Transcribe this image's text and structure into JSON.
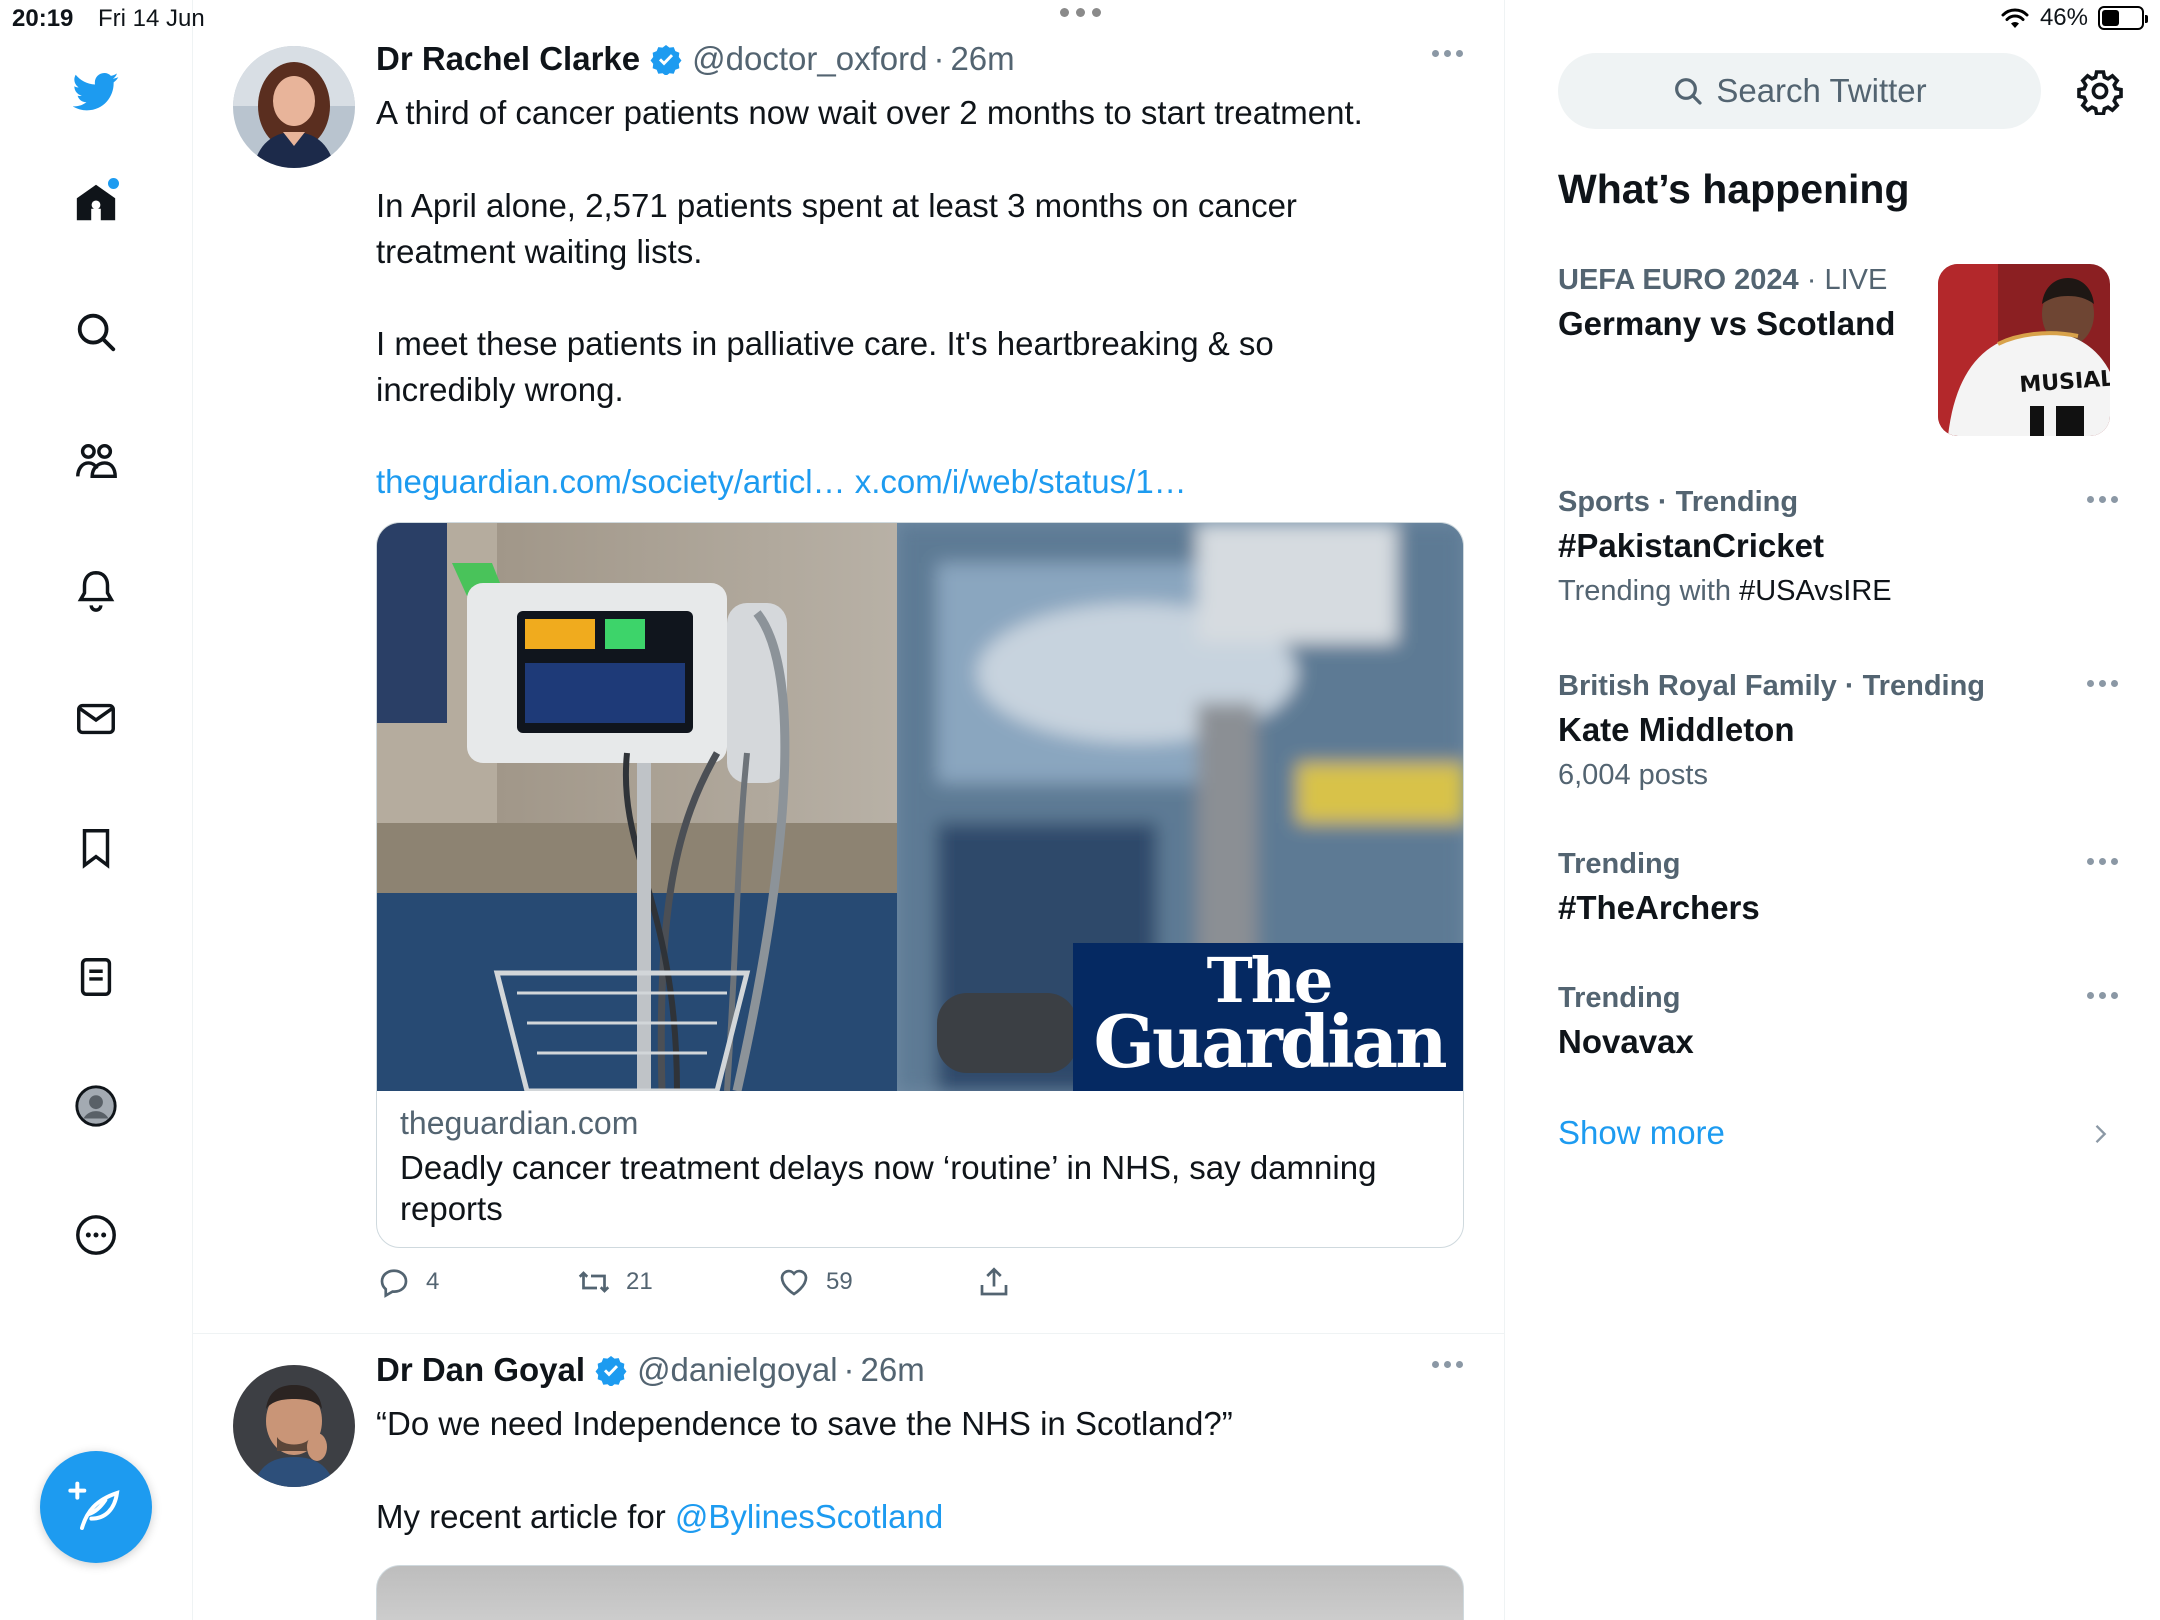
{
  "status_bar": {
    "time": "20:19",
    "date": "Fri 14 Jun",
    "battery": "46%",
    "battery_level": 0.46
  },
  "nav": {
    "items": [
      "twitter-logo",
      "home",
      "explore",
      "communities",
      "notifications",
      "messages",
      "bookmarks",
      "lists",
      "profile",
      "more"
    ],
    "compose": "compose-tweet"
  },
  "tweets": [
    {
      "name": "Dr Rachel Clarke",
      "handle": "@doctor_oxford",
      "sep": "·",
      "time": "26m",
      "paragraphs": [
        "A third of cancer patients now wait over 2 months to start treatment.",
        "In April alone, 2,571 patients spent at least 3 months on cancer treatment waiting lists.",
        "I meet these patients in palliative care. It's heartbreaking & so incredibly wrong."
      ],
      "links": [
        "theguardian.com/society/articl…",
        "x.com/i/web/status/1…"
      ],
      "card": {
        "brand_line1": "The",
        "brand_line2": "Guardian",
        "domain": "theguardian.com",
        "title": "Deadly cancer treatment delays now ‘routine’ in NHS, say damning reports"
      },
      "actions": {
        "replies": "4",
        "retweets": "21",
        "likes": "59"
      }
    },
    {
      "name": "Dr Dan Goyal",
      "handle": "@danielgoyal",
      "sep": "·",
      "time": "26m",
      "paragraphs": [
        "“Do we need Independence to save the NHS in Scotland?”",
        "My recent article for "
      ],
      "mention": "@BylinesScotland"
    }
  ],
  "sidebar": {
    "search_placeholder": "Search Twitter",
    "title": "What’s happening",
    "trends": [
      {
        "category": "UEFA EURO 2024",
        "sep": "·",
        "status": "LIVE",
        "name": "Germany vs Scotland",
        "jersey_name": "MUSIALA"
      },
      {
        "category": "Sports · Trending",
        "name": "#PakistanCricket",
        "sub_prefix": "Trending with ",
        "sub_value": "#USAvsIRE"
      },
      {
        "category": "British Royal Family · Trending",
        "name": "Kate Middleton",
        "sub": "6,004 posts"
      },
      {
        "category": "Trending",
        "name": "#TheArchers"
      },
      {
        "category": "Trending",
        "name": "Novavax"
      }
    ],
    "show_more": "Show more"
  },
  "colors": {
    "accent": "#1d9bf0",
    "guardian": "#052962",
    "text": "#0f1419",
    "muted": "#536471"
  }
}
